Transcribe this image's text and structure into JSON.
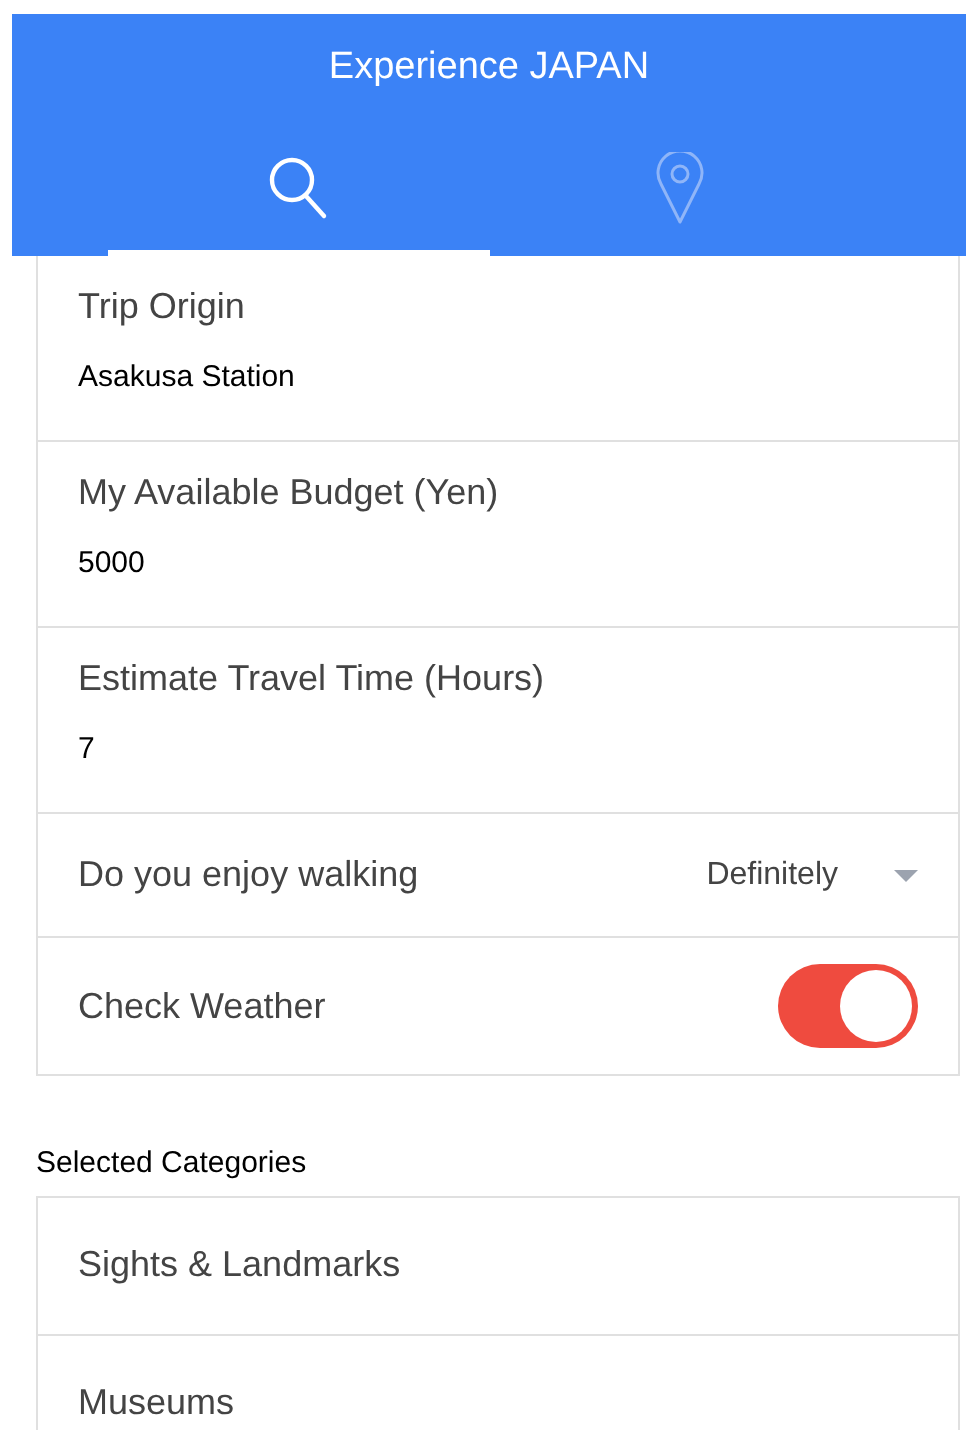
{
  "header": {
    "title": "Experience JAPAN"
  },
  "tabs": [
    {
      "kind": "search",
      "selected": true
    },
    {
      "kind": "pin",
      "selected": false
    }
  ],
  "form": [
    {
      "kind": "text",
      "label": "Trip Origin",
      "value": "Asakusa Station"
    },
    {
      "kind": "text",
      "label": "My Available Budget (Yen)",
      "value": "5000"
    },
    {
      "kind": "text",
      "label": "Estimate Travel Time (Hours)",
      "value": "7"
    },
    {
      "kind": "select",
      "label": "Do you enjoy walking",
      "value": "Definitely"
    },
    {
      "kind": "toggle",
      "label": "Check Weather",
      "on": true
    }
  ],
  "categories": {
    "heading": "Selected Categories",
    "items": [
      "Sights & Landmarks",
      "Museums"
    ]
  }
}
